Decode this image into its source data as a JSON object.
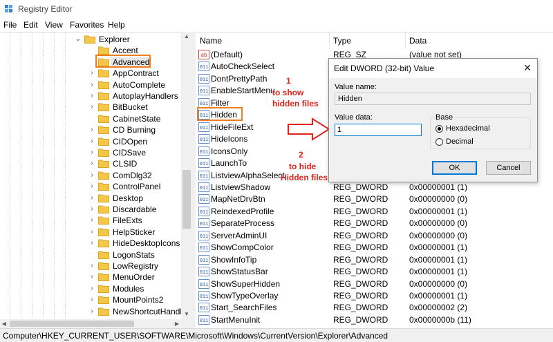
{
  "window": {
    "title": "Registry Editor"
  },
  "menu": [
    "File",
    "Edit",
    "View",
    "Favorites",
    "Help"
  ],
  "tree": {
    "items": [
      {
        "label": "Explorer",
        "expanded": true,
        "level": 0
      },
      {
        "label": "Accent",
        "level": 1
      },
      {
        "label": "Advanced",
        "level": 1,
        "selected": true
      },
      {
        "label": "AppContract",
        "level": 1,
        "expandable": true
      },
      {
        "label": "AutoComplete",
        "level": 1,
        "expandable": true
      },
      {
        "label": "AutoplayHandlers",
        "level": 1,
        "expandable": true
      },
      {
        "label": "BitBucket",
        "level": 1,
        "expandable": true
      },
      {
        "label": "CabinetState",
        "level": 1
      },
      {
        "label": "CD Burning",
        "level": 1,
        "expandable": true
      },
      {
        "label": "CIDOpen",
        "level": 1,
        "expandable": true
      },
      {
        "label": "CIDSave",
        "level": 1,
        "expandable": true
      },
      {
        "label": "CLSID",
        "level": 1,
        "expandable": true
      },
      {
        "label": "ComDlg32",
        "level": 1,
        "expandable": true
      },
      {
        "label": "ControlPanel",
        "level": 1,
        "expandable": true
      },
      {
        "label": "Desktop",
        "level": 1,
        "expandable": true
      },
      {
        "label": "Discardable",
        "level": 1,
        "expandable": true
      },
      {
        "label": "FileExts",
        "level": 1,
        "expandable": true
      },
      {
        "label": "HelpSticker",
        "level": 1,
        "expandable": true
      },
      {
        "label": "HideDesktopIcons",
        "level": 1,
        "expandable": true
      },
      {
        "label": "LogonStats",
        "level": 1
      },
      {
        "label": "LowRegistry",
        "level": 1,
        "expandable": true
      },
      {
        "label": "MenuOrder",
        "level": 1,
        "expandable": true
      },
      {
        "label": "Modules",
        "level": 1,
        "expandable": true
      },
      {
        "label": "MountPoints2",
        "level": 1,
        "expandable": true
      },
      {
        "label": "NewShortcutHandler",
        "level": 1,
        "expandable": true
      }
    ]
  },
  "list": {
    "columns": {
      "name": "Name",
      "type": "Type",
      "data": "Data"
    },
    "rows": [
      {
        "name": "(Default)",
        "type": "REG_SZ",
        "data": "(value not set)",
        "icon": "string-value-icon"
      },
      {
        "name": "AutoCheckSelect",
        "type": "",
        "data": "",
        "icon": "dword-value-icon"
      },
      {
        "name": "DontPrettyPath",
        "type": "",
        "data": "",
        "icon": "dword-value-icon"
      },
      {
        "name": "EnableStartMenu",
        "type": "",
        "data": "",
        "icon": "dword-value-icon"
      },
      {
        "name": "Filter",
        "type": "",
        "data": "",
        "icon": "dword-value-icon"
      },
      {
        "name": "Hidden",
        "type": "",
        "data": "",
        "icon": "dword-value-icon"
      },
      {
        "name": "HideFileExt",
        "type": "",
        "data": "",
        "icon": "dword-value-icon"
      },
      {
        "name": "HideIcons",
        "type": "",
        "data": "",
        "icon": "dword-value-icon"
      },
      {
        "name": "IconsOnly",
        "type": "",
        "data": "",
        "icon": "dword-value-icon"
      },
      {
        "name": "LaunchTo",
        "type": "",
        "data": "",
        "icon": "dword-value-icon"
      },
      {
        "name": "ListviewAlphaSelect",
        "type": "",
        "data": "",
        "icon": "dword-value-icon"
      },
      {
        "name": "ListviewShadow",
        "type": "REG_DWORD",
        "data": "0x00000001 (1)",
        "icon": "dword-value-icon"
      },
      {
        "name": "MapNetDrvBtn",
        "type": "REG_DWORD",
        "data": "0x00000000 (0)",
        "icon": "dword-value-icon"
      },
      {
        "name": "ReindexedProfile",
        "type": "REG_DWORD",
        "data": "0x00000001 (1)",
        "icon": "dword-value-icon"
      },
      {
        "name": "SeparateProcess",
        "type": "REG_DWORD",
        "data": "0x00000000 (0)",
        "icon": "dword-value-icon"
      },
      {
        "name": "ServerAdminUI",
        "type": "REG_DWORD",
        "data": "0x00000000 (0)",
        "icon": "dword-value-icon"
      },
      {
        "name": "ShowCompColor",
        "type": "REG_DWORD",
        "data": "0x00000001 (1)",
        "icon": "dword-value-icon"
      },
      {
        "name": "ShowInfoTip",
        "type": "REG_DWORD",
        "data": "0x00000001 (1)",
        "icon": "dword-value-icon"
      },
      {
        "name": "ShowStatusBar",
        "type": "REG_DWORD",
        "data": "0x00000001 (1)",
        "icon": "dword-value-icon"
      },
      {
        "name": "ShowSuperHidden",
        "type": "REG_DWORD",
        "data": "0x00000000 (0)",
        "icon": "dword-value-icon"
      },
      {
        "name": "ShowTypeOverlay",
        "type": "REG_DWORD",
        "data": "0x00000001 (1)",
        "icon": "dword-value-icon"
      },
      {
        "name": "Start_SearchFiles",
        "type": "REG_DWORD",
        "data": "0x00000002 (2)",
        "icon": "dword-value-icon"
      },
      {
        "name": "StartMenuInit",
        "type": "REG_DWORD",
        "data": "0x0000000b (11)",
        "icon": "dword-value-icon"
      }
    ]
  },
  "status": {
    "path": "Computer\\HKEY_CURRENT_USER\\SOFTWARE\\Microsoft\\Windows\\CurrentVersion\\Explorer\\Advanced"
  },
  "dialog": {
    "title": "Edit DWORD (32-bit) Value",
    "close": "✕",
    "value_name_label": "Value name:",
    "value_name": "Hidden",
    "value_data_label": "Value data:",
    "value_data": "1",
    "base_label": "Base",
    "radio_hex": "Hexadecimal",
    "radio_dec": "Decimal",
    "selected_base": "Hexadecimal",
    "ok": "OK",
    "cancel": "Cancel"
  },
  "annotations": {
    "a1_num": "1",
    "a1_l1": "to  show",
    "a1_l2": "hidden files",
    "a2_num": "2",
    "a2_l1": "to hide",
    "a2_l2": "Hidden files"
  },
  "colors": {
    "highlight": "#f07d1e",
    "annotation": "#e0231b",
    "folder": "#f4c64a",
    "accent": "#0078d7"
  }
}
